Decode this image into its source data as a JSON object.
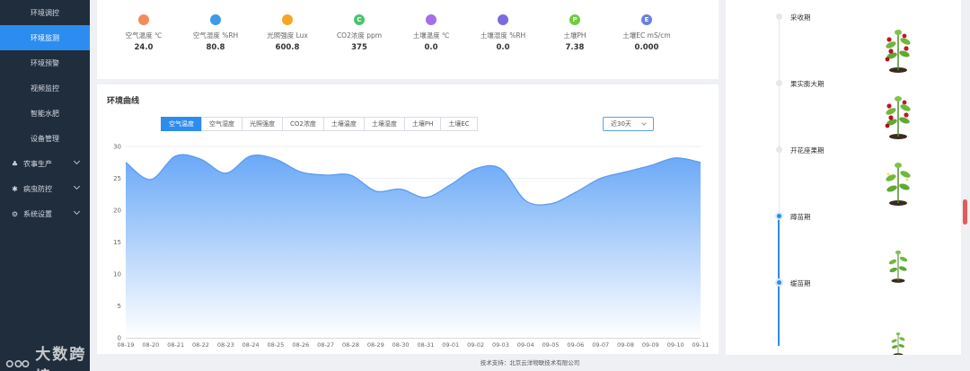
{
  "sidebar": {
    "items": [
      {
        "label": "环境调控",
        "active": false
      },
      {
        "label": "环境监测",
        "active": true
      },
      {
        "label": "环境预警",
        "active": false
      },
      {
        "label": "视频监控",
        "active": false
      },
      {
        "label": "智能水肥",
        "active": false
      },
      {
        "label": "设备管理",
        "active": false
      }
    ],
    "groups": [
      {
        "label": "农事生产",
        "icon": "sprout-icon"
      },
      {
        "label": "病虫防控",
        "icon": "bug-icon"
      },
      {
        "label": "系统设置",
        "icon": "gear-icon"
      }
    ],
    "watermark": "大数跨境"
  },
  "sensors": [
    {
      "label": "空气温度 ℃",
      "value": "24.0",
      "icon": "thermometer-icon",
      "color": "#f28b5b"
    },
    {
      "label": "空气湿度 %RH",
      "value": "80.8",
      "icon": "droplet-icon",
      "color": "#3d9be9"
    },
    {
      "label": "光照强度 Lux",
      "value": "600.8",
      "icon": "sun-icon",
      "color": "#f5a623"
    },
    {
      "label": "CO2浓度 ppm",
      "value": "375",
      "icon": "co2-icon",
      "color": "#4cc36f"
    },
    {
      "label": "土壤温度 ℃",
      "value": "0.0",
      "icon": "soil-temp-icon",
      "color": "#a56ee8"
    },
    {
      "label": "土壤湿度 %RH",
      "value": "0.0",
      "icon": "soil-moisture-icon",
      "color": "#7a6be0"
    },
    {
      "label": "土壤PH",
      "value": "7.38",
      "icon": "ph-icon",
      "color": "#6ccf3e"
    },
    {
      "label": "土壤EC mS/cm",
      "value": "0.000",
      "icon": "ec-icon",
      "color": "#6b7fe0"
    }
  ],
  "chart_section": {
    "title": "环境曲线",
    "tabs": [
      "空气温度",
      "空气湿度",
      "光照强度",
      "CO2浓度",
      "土壤温度",
      "土壤湿度",
      "土壤PH",
      "土壤EC"
    ],
    "active_tab": 0,
    "range": "近30天"
  },
  "chart_data": {
    "type": "area",
    "title": "",
    "xlabel": "",
    "ylabel": "",
    "ylim": [
      0,
      30
    ],
    "yticks": [
      0,
      5,
      10,
      15,
      20,
      25,
      30
    ],
    "grid": true,
    "categories": [
      "08-19",
      "08-20",
      "08-21",
      "08-22",
      "08-23",
      "08-24",
      "08-25",
      "08-26",
      "08-27",
      "08-28",
      "08-29",
      "08-30",
      "08-31",
      "09-01",
      "09-02",
      "09-03",
      "09-04",
      "09-05",
      "09-06",
      "09-07",
      "09-08",
      "09-09",
      "09-10",
      "09-11"
    ],
    "series": [
      {
        "values": [
          27.5,
          24.8,
          28.5,
          28.0,
          25.8,
          28.5,
          28.0,
          26.0,
          25.5,
          25.5,
          23.0,
          23.3,
          22.0,
          24.0,
          26.5,
          26.5,
          21.5,
          21.0,
          22.8,
          25.0,
          26.0,
          27.0,
          28.2,
          27.5
        ]
      }
    ],
    "fill_top": "#6aa8f7",
    "fill_bottom": "#ffffff",
    "line_color": "#5b9cf0"
  },
  "footer": {
    "text": "技术支持：北京云洋物联技术有限公司"
  },
  "timeline": {
    "stages": [
      {
        "name": "采收期",
        "active": false
      },
      {
        "name": "果实膨大期",
        "active": false
      },
      {
        "name": "开花座果期",
        "active": false
      },
      {
        "name": "蹲苗期",
        "active": true
      },
      {
        "name": "缓苗期",
        "active": true
      }
    ]
  }
}
